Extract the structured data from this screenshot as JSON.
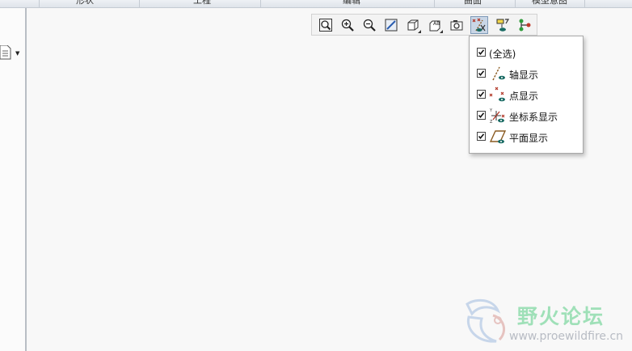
{
  "ribbon": {
    "tabs": [
      "形状",
      "工程",
      "编辑",
      "曲面",
      "模型意图"
    ]
  },
  "toolbar": {
    "buttons": [
      {
        "name": "refit-icon"
      },
      {
        "name": "zoom-in-icon"
      },
      {
        "name": "zoom-out-icon"
      },
      {
        "name": "repaint-icon"
      },
      {
        "name": "display-style-icon"
      },
      {
        "name": "saved-views-icon"
      },
      {
        "name": "view-manager-icon"
      },
      {
        "name": "datum-display-filters-icon",
        "active": true
      },
      {
        "name": "annotation-display-icon"
      },
      {
        "name": "spin-center-icon"
      }
    ]
  },
  "datum_menu": {
    "items": [
      {
        "label": "(全选)",
        "checked": true,
        "icon": ""
      },
      {
        "label": "轴显示",
        "checked": true,
        "icon": "axis-display-icon"
      },
      {
        "label": "点显示",
        "checked": true,
        "icon": "point-display-icon"
      },
      {
        "label": "坐标系显示",
        "checked": true,
        "icon": "csys-display-icon"
      },
      {
        "label": "平面显示",
        "checked": true,
        "icon": "plane-display-icon"
      }
    ]
  },
  "watermark": {
    "title": "野火论坛",
    "url": "www.proewildfire.cn"
  },
  "colors": {
    "watermark_green": "#9fe0b8",
    "active_button": "#c9d6e6",
    "eye_teal": "#1a6b64",
    "axis_brown": "#8a5a20",
    "point_red": "#b03020"
  }
}
